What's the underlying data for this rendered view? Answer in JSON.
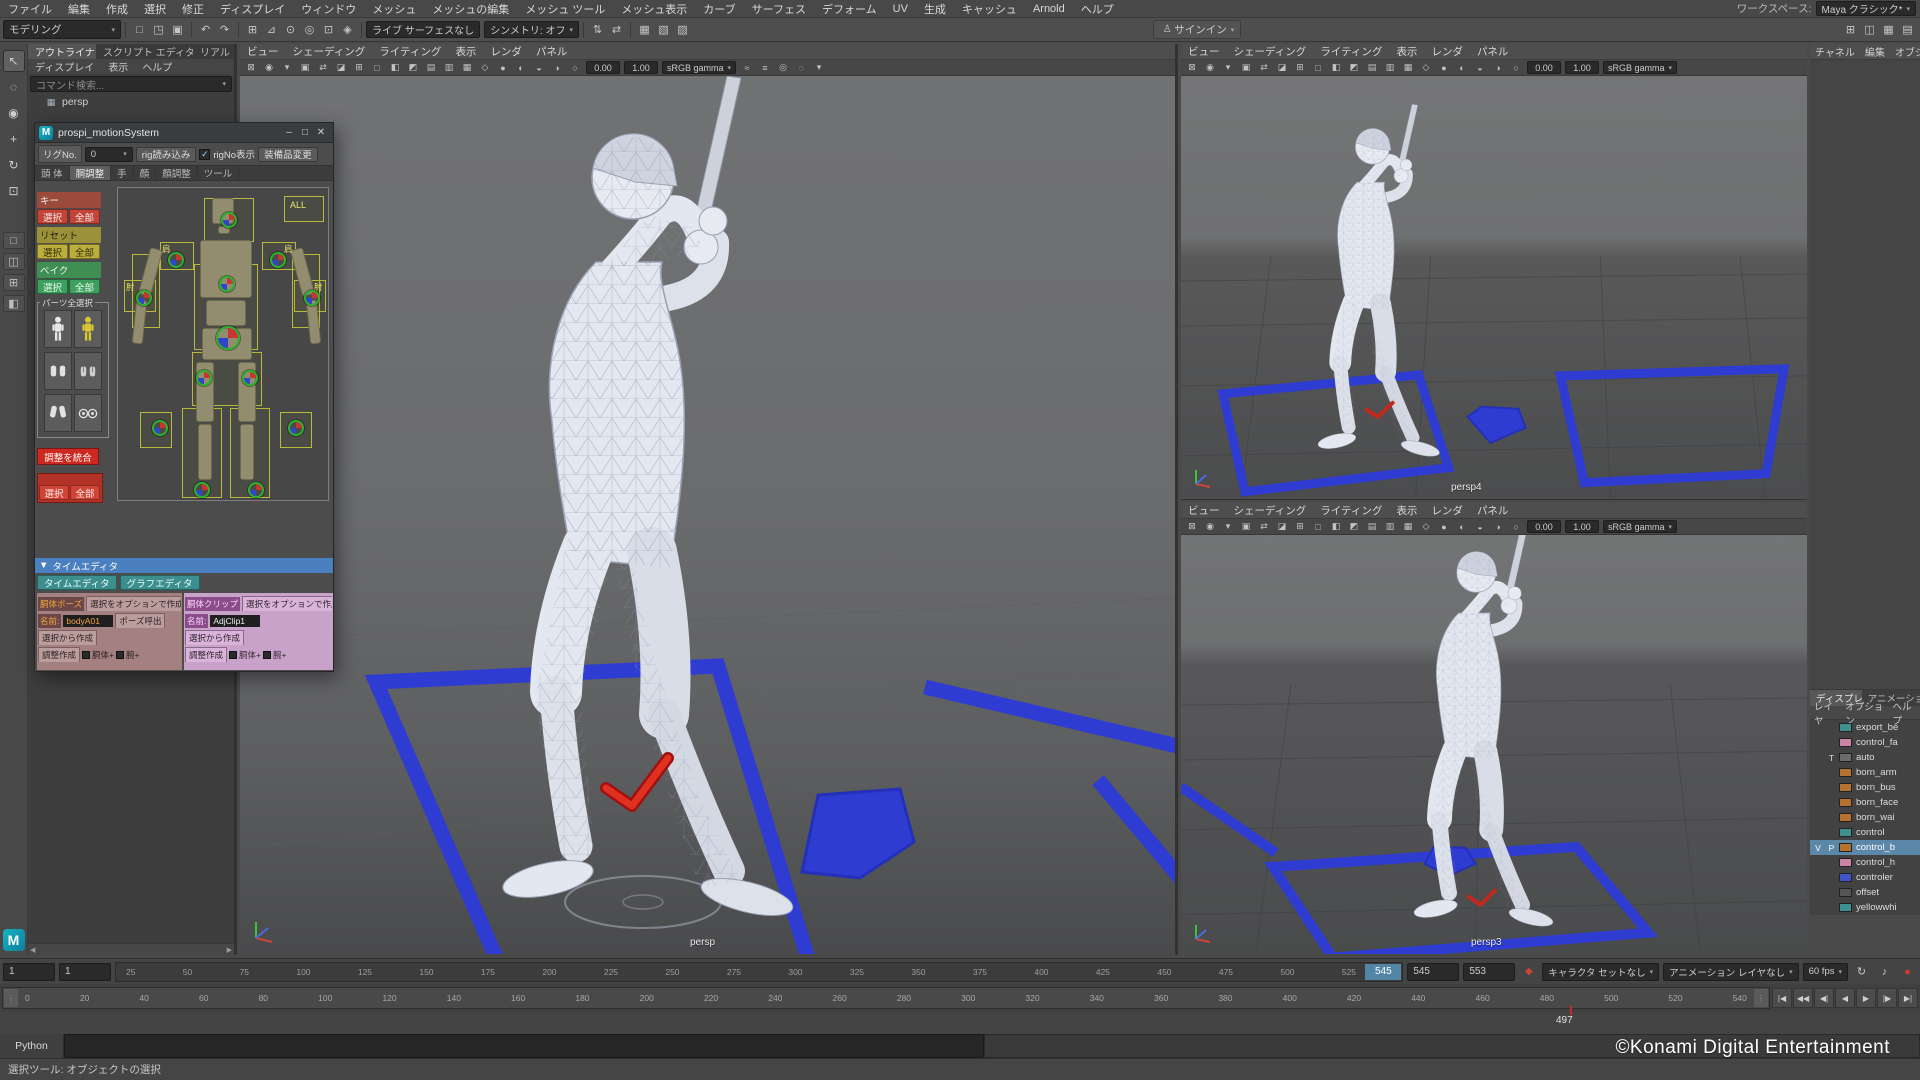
{
  "menubar": {
    "items": [
      "ファイル",
      "編集",
      "作成",
      "選択",
      "修正",
      "ディスプレイ",
      "ウィンドウ",
      "メッシュ",
      "メッシュの編集",
      "メッシュ ツール",
      "メッシュ表示",
      "カーブ",
      "サーフェス",
      "デフォーム",
      "UV",
      "生成",
      "キャッシュ",
      "Arnold",
      "ヘルプ"
    ],
    "workspace_label": "ワークスペース:",
    "workspace_value": "Maya クラシック*"
  },
  "statusline": {
    "mode": "モデリング",
    "live_surface": "ライブ サーフェスなし",
    "symmetry": "シンメトリ: オフ",
    "signin": "サインイン",
    "file_icons": [
      {
        "n": "new-scene-icon",
        "g": "□"
      },
      {
        "n": "open-scene-icon",
        "g": "◳"
      },
      {
        "n": "save-scene-icon",
        "g": "▣"
      }
    ],
    "undo_icons": [
      {
        "n": "undo-icon",
        "g": "↶"
      },
      {
        "n": "redo-icon",
        "g": "↷"
      }
    ],
    "snap_icons": [
      {
        "n": "snap-to-grid-icon",
        "g": "⊞"
      },
      {
        "n": "snap-to-curve-icon",
        "g": "⊿"
      },
      {
        "n": "snap-to-point-icon",
        "g": "⊙"
      },
      {
        "n": "snap-to-projected-center-icon",
        "g": "◎"
      },
      {
        "n": "snap-to-view-plane-icon",
        "g": "⊡"
      },
      {
        "n": "make-object-live-icon",
        "g": "◈"
      }
    ],
    "history_icons": [
      {
        "n": "construction-history-icon",
        "g": "⇅"
      },
      {
        "n": "select-by-input-icon",
        "g": "⇄"
      }
    ],
    "render_icons": [
      {
        "n": "render-current-frame-icon",
        "g": "▦"
      },
      {
        "n": "ipr-render-icon",
        "g": "▧"
      },
      {
        "n": "render-settings-icon",
        "g": "▨"
      }
    ],
    "right_icons": [
      {
        "n": "grid-toggle-icon",
        "g": "⊞"
      },
      {
        "n": "viewport-layout-icon",
        "g": "◫"
      },
      {
        "n": "hypershade-icon",
        "g": "▦"
      },
      {
        "n": "node-editor-icon",
        "g": "▤"
      }
    ]
  },
  "toolbox": {
    "tools": [
      {
        "n": "select-tool-icon",
        "g": "↖",
        "active": true
      },
      {
        "n": "lasso-tool-icon",
        "g": "◌"
      },
      {
        "n": "paint-select-tool-icon",
        "g": "◉"
      },
      {
        "n": "move-tool-icon",
        "g": "+"
      },
      {
        "n": "rotate-tool-icon",
        "g": "↻"
      },
      {
        "n": "scale-tool-icon",
        "g": "⊡"
      }
    ],
    "layouts": [
      {
        "n": "single-pane-layout-icon",
        "g": "□"
      },
      {
        "n": "two-pane-layout-icon",
        "g": "◫"
      },
      {
        "n": "four-pane-layout-icon",
        "g": "⊞"
      },
      {
        "n": "outliner-persp-layout-icon",
        "g": "◧"
      }
    ]
  },
  "outliner": {
    "tabs": [
      {
        "label": "アウトライナ",
        "active": true
      },
      {
        "label": "スクリプト エディタ"
      },
      {
        "label": "リアル"
      }
    ],
    "menus": [
      "ディスプレイ",
      "表示",
      "ヘルプ"
    ],
    "search_placeholder": "コマンド検索...",
    "items": [
      {
        "name": "persp"
      }
    ]
  },
  "rig_window": {
    "title": "prospi_motionSystem",
    "rig_no_label": "リグNo.",
    "rig_no_value": "0",
    "load_rig_button": "rig読み込み",
    "rig_no_checkbox_label": "rigNo表示",
    "equipment_button": "装備品変更",
    "tabs": [
      {
        "label": "頭 体"
      },
      {
        "label": "胴調整",
        "active": true
      },
      {
        "label": "手"
      },
      {
        "label": "顔"
      },
      {
        "label": "顔調整"
      },
      {
        "label": "ツール"
      }
    ],
    "key_section": {
      "title": "キー",
      "select": "選択",
      "all": "全部"
    },
    "reset_section": {
      "title": "リセット",
      "select": "選択",
      "all": "全部"
    },
    "bake_section": {
      "title": "ベイク",
      "select": "選択",
      "all": "全部"
    },
    "parts_label": "パーツ全選択",
    "diagram": {
      "all_label": "ALL",
      "shoulder_label": "肩",
      "elbow_label": "肘"
    },
    "merge_button": "調整を統合",
    "adjust_section": {
      "select": "選択",
      "all": "全部"
    },
    "time_editor_header": "タイムエディタ",
    "time_editor_button": "タイムエディタ",
    "graph_editor_button": "グラフエディタ",
    "pose_section": {
      "title": "胴体ポーズ",
      "create_with_options": "選択をオプションで作成",
      "name_label": "名前:",
      "name_value": "bodyA01",
      "recall_button": "ポーズ呼出",
      "create_from_selection": "選択から作成",
      "adjust_create": "調整作成",
      "torso_checkbox": "胴体+",
      "arm_checkbox": "腕+"
    },
    "clip_section": {
      "title": "胴体クリップ",
      "create_with_options": "選択をオプションで作成",
      "name_label": "名前:",
      "name_value": "AdjClip1",
      "create_from_selection": "選択から作成",
      "adjust_create": "調整作成",
      "torso_checkbox": "胴体+",
      "arm_checkbox": "腕+"
    }
  },
  "viewport": {
    "menu": [
      "ビュー",
      "シェーディング",
      "ライティング",
      "表示",
      "レンダ",
      "パネル"
    ],
    "exposure": "0.00",
    "gamma": "1.00",
    "color_space": "sRGB gamma",
    "labels": {
      "main": "persp",
      "top_right": "persp4",
      "bottom_right": "persp3"
    },
    "toolbar_icons": [
      {
        "n": "lock-camera-icon",
        "g": "⊠"
      },
      {
        "n": "camera-attributes-icon",
        "g": "◉"
      },
      {
        "n": "bookmarks-icon",
        "g": "▾"
      },
      {
        "n": "image-plane-icon",
        "g": "▣"
      },
      {
        "n": "2d-pan-zoom-icon",
        "g": "⇄"
      },
      {
        "n": "grease-pencil-icon",
        "g": "◪"
      },
      {
        "n": "grid-toggle-icon",
        "g": "⊞"
      },
      {
        "n": "film-gate-icon",
        "g": "□"
      },
      {
        "n": "resolution-gate-icon",
        "g": "◧"
      },
      {
        "n": "gate-mask-icon",
        "g": "◩"
      },
      {
        "n": "field-chart-icon",
        "g": "▤"
      },
      {
        "n": "safe-action-icon",
        "g": "▥"
      },
      {
        "n": "safe-title-icon",
        "g": "▦"
      },
      {
        "n": "wireframe-mode-icon",
        "g": "◇"
      },
      {
        "n": "shaded-mode-icon",
        "g": "●"
      },
      {
        "n": "textured-mode-icon",
        "g": "◐"
      },
      {
        "n": "use-default-material-icon",
        "g": "◒"
      },
      {
        "n": "shadows-icon",
        "g": "◑"
      },
      {
        "n": "screen-space-ao-icon",
        "g": "○"
      }
    ],
    "trailing_icons": [
      {
        "n": "motion-blur-icon",
        "g": "≈"
      },
      {
        "n": "anti-aliasing-icon",
        "g": "≡"
      },
      {
        "n": "isolate-select-icon",
        "g": "◎"
      },
      {
        "n": "xray-icon",
        "g": "◌"
      },
      {
        "n": "viewport-renderer-icon",
        "g": "▾"
      }
    ]
  },
  "channel_box": {
    "menus": [
      "チャネル",
      "編集",
      "オブジェクト"
    ]
  },
  "layer_editor": {
    "tabs": [
      {
        "label": "ディスプレイ",
        "active": true
      },
      {
        "label": "アニメーション"
      }
    ],
    "menus": [
      "レイヤ",
      "オプション",
      "ヘルプ"
    ],
    "rows": [
      {
        "v": "",
        "t": "",
        "c": "#3f9090",
        "name": "export_be"
      },
      {
        "v": "",
        "t": "",
        "c": "#c985a8",
        "name": "control_fa"
      },
      {
        "v": "",
        "t": "T",
        "c": "#6a6a6a",
        "name": "auto"
      },
      {
        "v": "",
        "t": "",
        "c": "#b5722e",
        "name": "born_arm"
      },
      {
        "v": "",
        "t": "",
        "c": "#b5722e",
        "name": "born_bus"
      },
      {
        "v": "",
        "t": "",
        "c": "#b5722e",
        "name": "born_face"
      },
      {
        "v": "",
        "t": "",
        "c": "#b5722e",
        "name": "born_wai"
      },
      {
        "v": "",
        "t": "",
        "c": "#3f9090",
        "name": "control"
      },
      {
        "v": "V",
        "t": "P",
        "c": "#b5722e",
        "name": "control_b",
        "sel": true
      },
      {
        "v": "",
        "t": "",
        "c": "#c985a8",
        "name": "control_h"
      },
      {
        "v": "",
        "t": "",
        "c": "#4054c8",
        "name": "controler"
      },
      {
        "v": "",
        "t": "",
        "c": "#555555",
        "name": "offset"
      },
      {
        "v": "",
        "t": "",
        "c": "#3f9090",
        "name": "yellowwhi"
      }
    ]
  },
  "timeline": {
    "start_field": "1",
    "playback_start_field": "1",
    "time_ticks": [
      "25",
      "50",
      "75",
      "100",
      "125",
      "150",
      "175",
      "200",
      "225",
      "250",
      "275",
      "300",
      "325",
      "350",
      "375",
      "400",
      "425",
      "450",
      "475",
      "500",
      "525"
    ],
    "current_frame": "545",
    "playback_end_field": "545",
    "end_field": "553",
    "character_set": "キャラクタ セットなし",
    "animation_layer": "アニメーション レイヤなし",
    "fps": "60 fps",
    "range_ticks": [
      "0",
      "20",
      "40",
      "60",
      "80",
      "100",
      "120",
      "140",
      "160",
      "180",
      "200",
      "220",
      "240",
      "260",
      "280",
      "300",
      "320",
      "340",
      "360",
      "380",
      "400",
      "420",
      "440",
      "460",
      "480",
      "500",
      "520",
      "540"
    ],
    "range_current": "497",
    "playback_buttons": [
      {
        "n": "go-to-start-button",
        "g": "|◀"
      },
      {
        "n": "step-back-key-button",
        "g": "◀◀"
      },
      {
        "n": "step-back-frame-button",
        "g": "◀|"
      },
      {
        "n": "play-backwards-button",
        "g": "◀"
      },
      {
        "n": "play-forward-button",
        "g": "▶"
      },
      {
        "n": "step-forward-frame-button",
        "g": "|▶"
      },
      {
        "n": "go-to-end-button",
        "g": "▶|"
      }
    ]
  },
  "command_line": {
    "label": "Python"
  },
  "help_line": {
    "text": "選択ツール: オブジェクトの選択"
  },
  "watermark": "©Konami Digital Entertainment"
}
